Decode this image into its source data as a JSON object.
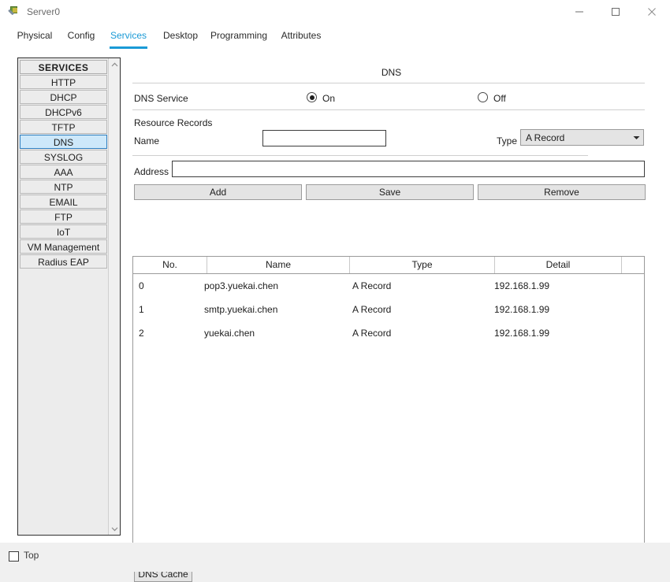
{
  "window": {
    "title": "Server0",
    "icon": "device-server-icon",
    "controls": [
      {
        "name": "minimize",
        "glyph": "minimize-icon"
      },
      {
        "name": "maximize",
        "glyph": "maximize-icon"
      },
      {
        "name": "close",
        "glyph": "close-icon"
      }
    ]
  },
  "tabs": [
    {
      "label": "Physical",
      "active": false
    },
    {
      "label": "Config",
      "active": false
    },
    {
      "label": "Services",
      "active": true
    },
    {
      "label": "Desktop",
      "active": false
    },
    {
      "label": "Programming",
      "active": false
    },
    {
      "label": "Attributes",
      "active": false
    }
  ],
  "sidebar": {
    "header": "SERVICES",
    "items": [
      {
        "label": "HTTP",
        "selected": false
      },
      {
        "label": "DHCP",
        "selected": false
      },
      {
        "label": "DHCPv6",
        "selected": false
      },
      {
        "label": "TFTP",
        "selected": false
      },
      {
        "label": "DNS",
        "selected": true
      },
      {
        "label": "SYSLOG",
        "selected": false
      },
      {
        "label": "AAA",
        "selected": false
      },
      {
        "label": "NTP",
        "selected": false
      },
      {
        "label": "EMAIL",
        "selected": false
      },
      {
        "label": "FTP",
        "selected": false
      },
      {
        "label": "IoT",
        "selected": false
      },
      {
        "label": "VM Management",
        "selected": false
      },
      {
        "label": "Radius EAP",
        "selected": false
      }
    ],
    "scroll_up_icon": "chevron-up-icon",
    "scroll_down_icon": "chevron-down-icon"
  },
  "panel": {
    "title": "DNS",
    "service_label": "DNS Service",
    "service_on_label": "On",
    "service_off_label": "Off",
    "service_state": "On",
    "resource_records_label": "Resource Records",
    "name_label": "Name",
    "name_value": "",
    "name_placeholder": "",
    "type_label": "Type",
    "type_value": "A Record",
    "type_arrow_icon": "chevron-down-icon",
    "address_label": "Address",
    "address_value": "",
    "address_placeholder": "",
    "buttons": {
      "add": "Add",
      "save": "Save",
      "remove": "Remove",
      "dns_cache": "DNS Cache"
    },
    "table": {
      "columns": [
        "No.",
        "Name",
        "Type",
        "Detail"
      ],
      "rows": [
        {
          "no": "0",
          "name": "pop3.yuekai.chen",
          "type": "A Record",
          "detail": "192.168.1.99"
        },
        {
          "no": "1",
          "name": "smtp.yuekai.chen",
          "type": "A Record",
          "detail": "192.168.1.99"
        },
        {
          "no": "2",
          "name": "yuekai.chen",
          "type": "A Record",
          "detail": "192.168.1.99"
        }
      ]
    }
  },
  "footer": {
    "top_checkbox_label": "Top",
    "top_checked": false
  },
  "colors": {
    "accent": "#1a9ad6",
    "selection_bg": "#cde8fa",
    "selection_border": "#2f7fc0",
    "window_bg": "#f0f0f0",
    "content_bg": "#ffffff",
    "control_face": "#e4e4e4"
  }
}
